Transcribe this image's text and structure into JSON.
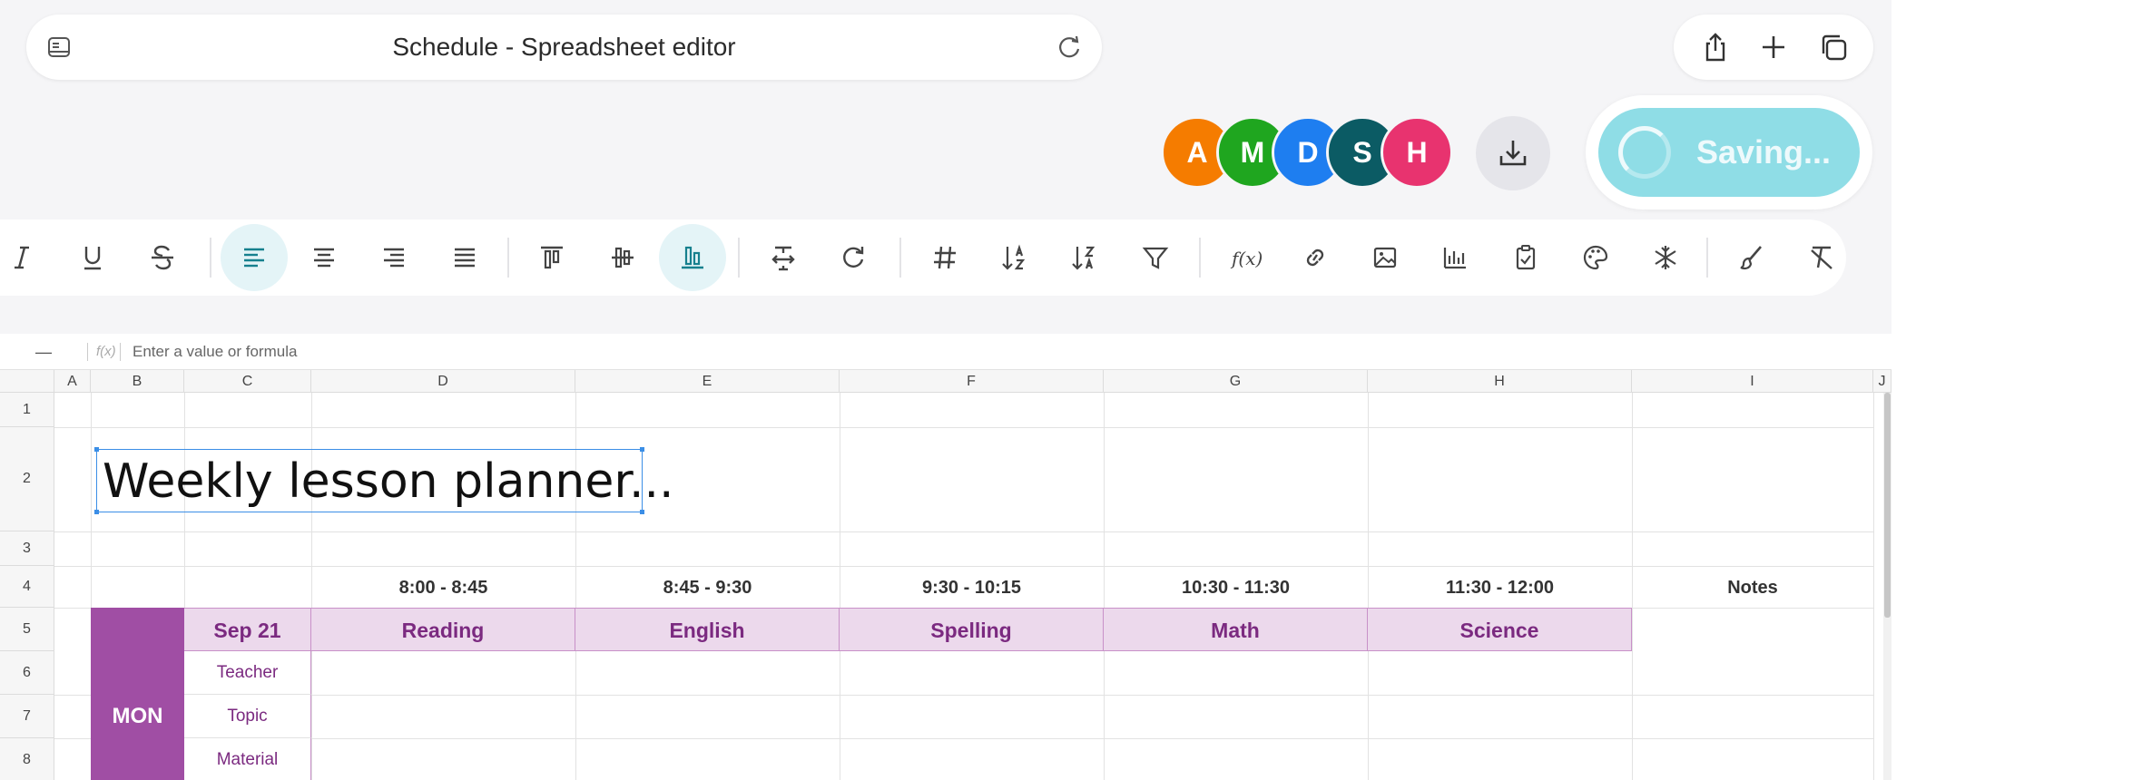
{
  "address_bar": {
    "title": "Schedule - Spreadsheet editor"
  },
  "collaborators": [
    {
      "initial": "A",
      "color": "#f57c00"
    },
    {
      "initial": "M",
      "color": "#1fa61f"
    },
    {
      "initial": "D",
      "color": "#1e7ef0"
    },
    {
      "initial": "S",
      "color": "#0b5b64"
    },
    {
      "initial": "H",
      "color": "#e8336f"
    }
  ],
  "saving": {
    "label": "Saving..."
  },
  "formula_bar": {
    "cell_ref": "—",
    "fx_label": "f(x)",
    "placeholder": "Enter a value or formula"
  },
  "columns": [
    "A",
    "B",
    "C",
    "D",
    "E",
    "F",
    "G",
    "H",
    "I",
    "J"
  ],
  "rows": [
    "1",
    "2",
    "3",
    "4",
    "5",
    "6",
    "7",
    "8"
  ],
  "sheet": {
    "title": "Weekly lesson planner...",
    "time_slots": [
      "8:00 - 8:45",
      "8:45 - 9:30",
      "9:30 - 10:15",
      "10:30 - 11:30",
      "11:30 - 12:00"
    ],
    "notes_header": "Notes",
    "date": "Sep 21",
    "subjects": [
      "Reading",
      "English",
      "Spelling",
      "Math",
      "Science"
    ],
    "day": "MON",
    "row_labels": [
      "Teacher",
      "Topic",
      "Material"
    ]
  },
  "colors": {
    "accent": "#8fdde6",
    "day_fill": "#a04ea4",
    "subject_fill": "#ecd9ec",
    "selection": "#3b8ee6"
  }
}
